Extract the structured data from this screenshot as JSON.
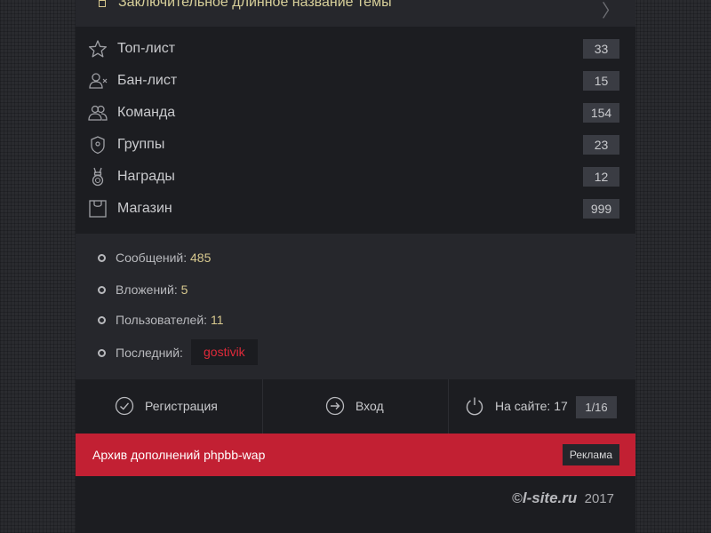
{
  "topic": {
    "title": "Заключительное длинное название темы"
  },
  "menu": [
    {
      "label": "Топ-лист",
      "count": "33",
      "icon": "star-icon"
    },
    {
      "label": "Бан-лист",
      "count": "15",
      "icon": "user-ban-icon"
    },
    {
      "label": "Команда",
      "count": "154",
      "icon": "team-icon"
    },
    {
      "label": "Группы",
      "count": "23",
      "icon": "shield-icon"
    },
    {
      "label": "Награды",
      "count": "12",
      "icon": "medal-icon"
    },
    {
      "label": "Магазин",
      "count": "999",
      "icon": "shop-bag-icon"
    }
  ],
  "stats": {
    "messages_label": "Сообщений:",
    "messages": "485",
    "attachments_label": "Вложений:",
    "attachments": "5",
    "users_label": "Пользователей:",
    "users": "11",
    "last_label": "Последний:",
    "last_user": "gostivik"
  },
  "actions": {
    "register": "Регистрация",
    "login": "Вход",
    "online_label": "На сайте: 17",
    "online_ratio": "1/16"
  },
  "banner": {
    "text": "Архив дополнений phpbb-wap",
    "ad_label": "Реклама"
  },
  "footer": {
    "symbol": "©",
    "brand": "l-site.ru",
    "year": "2017"
  },
  "colors": {
    "accent_red": "#c22033",
    "highlight": "#d8c98f",
    "user_red": "#e02a3a"
  }
}
